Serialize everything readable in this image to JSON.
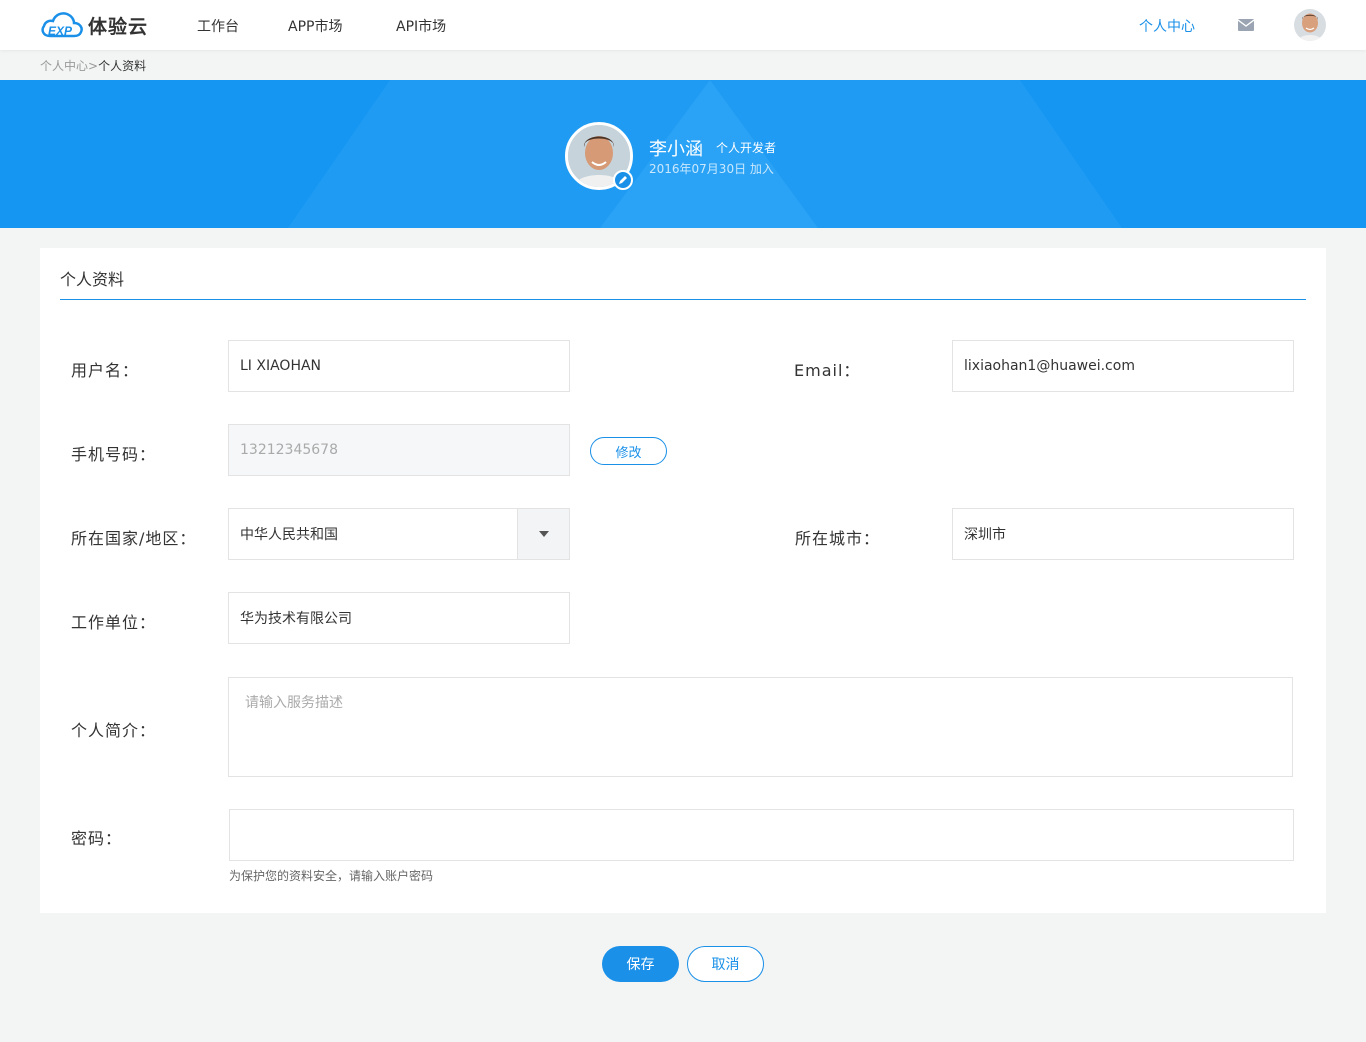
{
  "app": {
    "brand": "体验云",
    "logo_mark": "EXP"
  },
  "nav": {
    "items": [
      "工作台",
      "APP市场",
      "API市场"
    ],
    "right_link": "个人中心"
  },
  "icons": {
    "mail": "mail-icon",
    "edit": "edit-pencil-icon",
    "dropdown": "caret-down-icon"
  },
  "breadcrumb": {
    "parent": "个人中心",
    "separator": ">",
    "current": "个人资料"
  },
  "profile": {
    "name": "李小涵",
    "role": "个人开发者",
    "joined": "2016年07月30日  加入"
  },
  "form": {
    "title": "个人资料",
    "username": {
      "label": "用户名：",
      "value": "LI XIAOHAN"
    },
    "email": {
      "label": "Email：",
      "value": "lixiaohan1@huawei.com"
    },
    "phone": {
      "label": "手机号码：",
      "value": "13212345678",
      "modify_label": "修改"
    },
    "country": {
      "label": "所在国家/地区：",
      "value": "中华人民共和国"
    },
    "city": {
      "label": "所在城市：",
      "value": "深圳市"
    },
    "company": {
      "label": "工作单位：",
      "value": "华为技术有限公司"
    },
    "bio": {
      "label": "个人简介：",
      "placeholder": "请输入服务描述"
    },
    "password": {
      "label": "密码：",
      "value": "",
      "hint": "为保护您的资料安全，请输入账户密码"
    }
  },
  "actions": {
    "save": "保存",
    "cancel": "取消"
  },
  "colors": {
    "accent": "#1a90e8",
    "banner": "#1496f2"
  }
}
